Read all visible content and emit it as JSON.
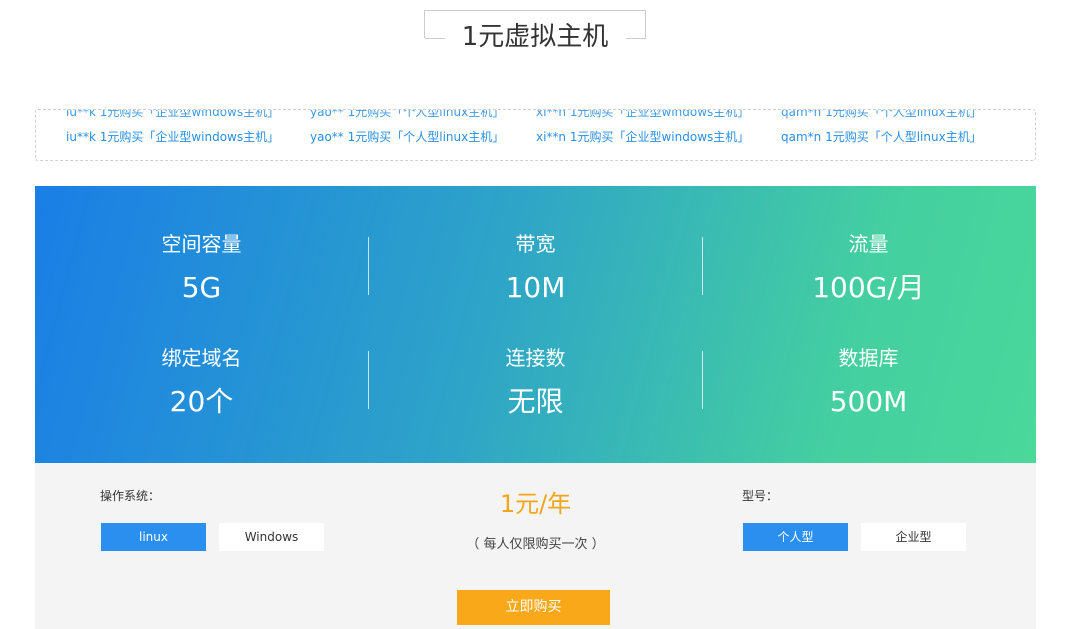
{
  "title": "1元虚拟主机",
  "ticker": {
    "items": [
      "iu**k 1元购买「企业型windows主机」",
      "yao** 1元购买「个人型linux主机」",
      "xi**n 1元购买「企业型windows主机」",
      "qam*n 1元购买「个人型linux主机」"
    ]
  },
  "specs": [
    {
      "label": "空间容量",
      "value": "5G"
    },
    {
      "label": "带宽",
      "value": "10M"
    },
    {
      "label": "流量",
      "value": "100G/月"
    },
    {
      "label": "绑定域名",
      "value": "20个"
    },
    {
      "label": "连接数",
      "value": "无限"
    },
    {
      "label": "数据库",
      "value": "500M"
    }
  ],
  "purchase": {
    "os_label": "操作系统：",
    "os_options": [
      "linux",
      "Windows"
    ],
    "os_selected": "linux",
    "price": "1元/年",
    "price_note": "（ 每人仅限购买一次 ）",
    "type_label": "型号：",
    "type_options": [
      "个人型",
      "企业型"
    ],
    "type_selected": "个人型",
    "buy_label": "立即购买"
  },
  "colors": {
    "accent_blue": "#2b8ff0",
    "price_orange": "#f4a51c",
    "buy_orange": "#f9a81a",
    "gradient_start": "#1a7ee6",
    "gradient_end": "#4ad89b"
  }
}
